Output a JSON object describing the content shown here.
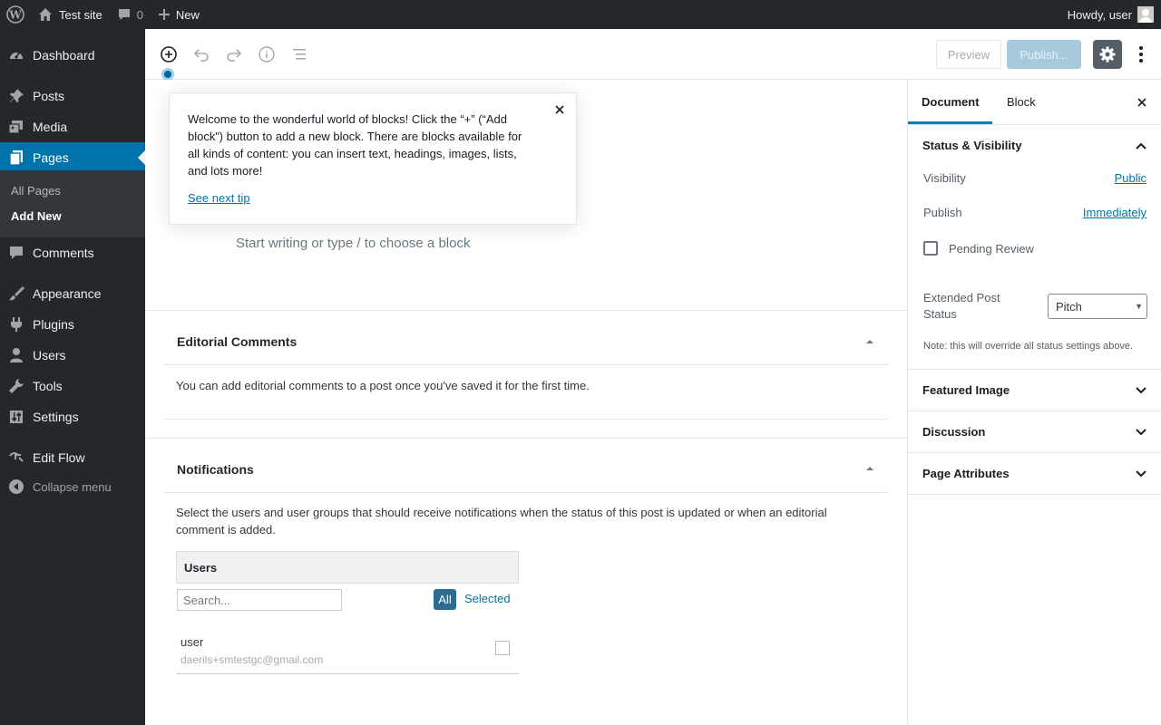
{
  "adminbar": {
    "site_name": "Test site",
    "comments_count": "0",
    "new_label": "New",
    "howdy": "Howdy, user"
  },
  "menu": {
    "dashboard": "Dashboard",
    "posts": "Posts",
    "media": "Media",
    "pages": "Pages",
    "all_pages": "All Pages",
    "add_new": "Add New",
    "comments": "Comments",
    "appearance": "Appearance",
    "plugins": "Plugins",
    "users": "Users",
    "tools": "Tools",
    "settings": "Settings",
    "edit_flow": "Edit Flow",
    "collapse": "Collapse menu"
  },
  "toolbar": {
    "preview": "Preview",
    "publish": "Publish..."
  },
  "tip": {
    "text": "Welcome to the wonderful world of blocks! Click the “+” (“Add block”) button to add a new block. There are blocks available for all kinds of content: you can insert text, headings, images, lists, and lots more!",
    "next": "See next tip"
  },
  "editor": {
    "placeholder": "Start writing or type / to choose a block"
  },
  "editorial_comments": {
    "title": "Editorial Comments",
    "body": "You can add editorial comments to a post once you've saved it for the first time."
  },
  "notifications": {
    "title": "Notifications",
    "body": "Select the users and user groups that should receive notifications when the status of this post is updated or when an editorial comment is added.",
    "users_header": "Users",
    "search_placeholder": "Search...",
    "all": "All",
    "selected": "Selected",
    "user_name": "user",
    "user_email": "daerils+smtestgc@gmail.com"
  },
  "sidebar": {
    "tab_document": "Document",
    "tab_block": "Block",
    "status_title": "Status & Visibility",
    "visibility_label": "Visibility",
    "visibility_value": "Public",
    "publish_label": "Publish",
    "publish_value": "Immediately",
    "pending_review": "Pending Review",
    "extended_status_label": "Extended Post Status",
    "extended_status_value": "Pitch",
    "note": "Note: this will override all status settings above.",
    "featured_image": "Featured Image",
    "discussion": "Discussion",
    "page_attributes": "Page Attributes"
  },
  "colors": {
    "accent": "#0073aa",
    "admin_dark": "#23282d",
    "publish_disabled": "#a6c9dc"
  }
}
